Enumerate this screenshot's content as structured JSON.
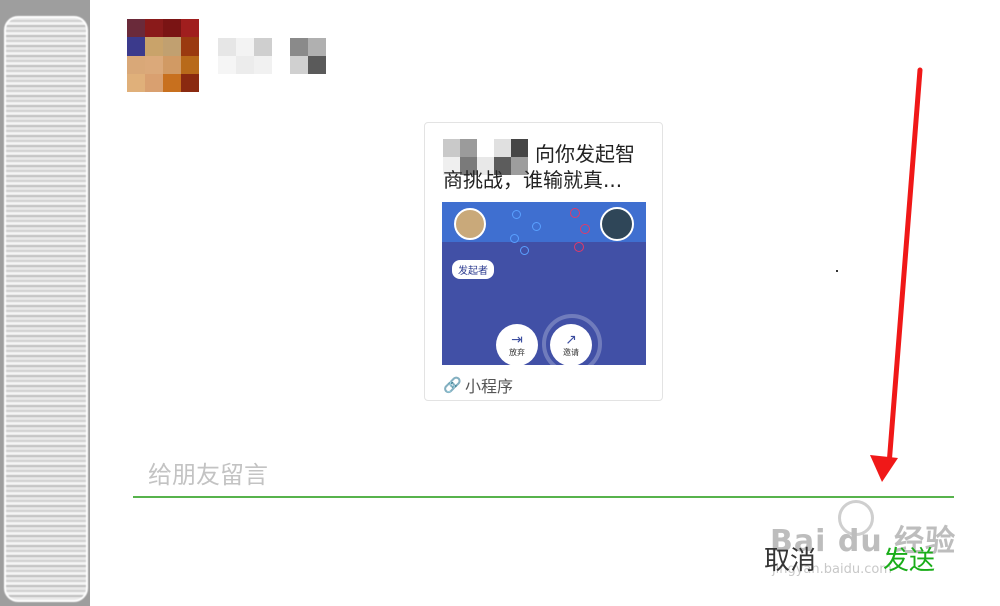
{
  "card": {
    "title_line1": "向你发起智",
    "title_line2": "商挑战，谁输就真...",
    "thumbnail": {
      "tag_label": "发起者",
      "giveup_label": "放弃",
      "invite_label": "邀请"
    },
    "mini_program_label": "小程序",
    "mini_program_icon": "link-icon"
  },
  "message_input": {
    "placeholder": "给朋友留言",
    "underline_color": "#57b34c"
  },
  "actions": {
    "cancel_label": "取消",
    "send_label": "发送",
    "send_color": "#1aad19"
  },
  "annotation": {
    "arrow_color": "#f01818"
  },
  "watermark": {
    "text": "Bai du 经验",
    "sub": "jingyan.baidu.com"
  }
}
